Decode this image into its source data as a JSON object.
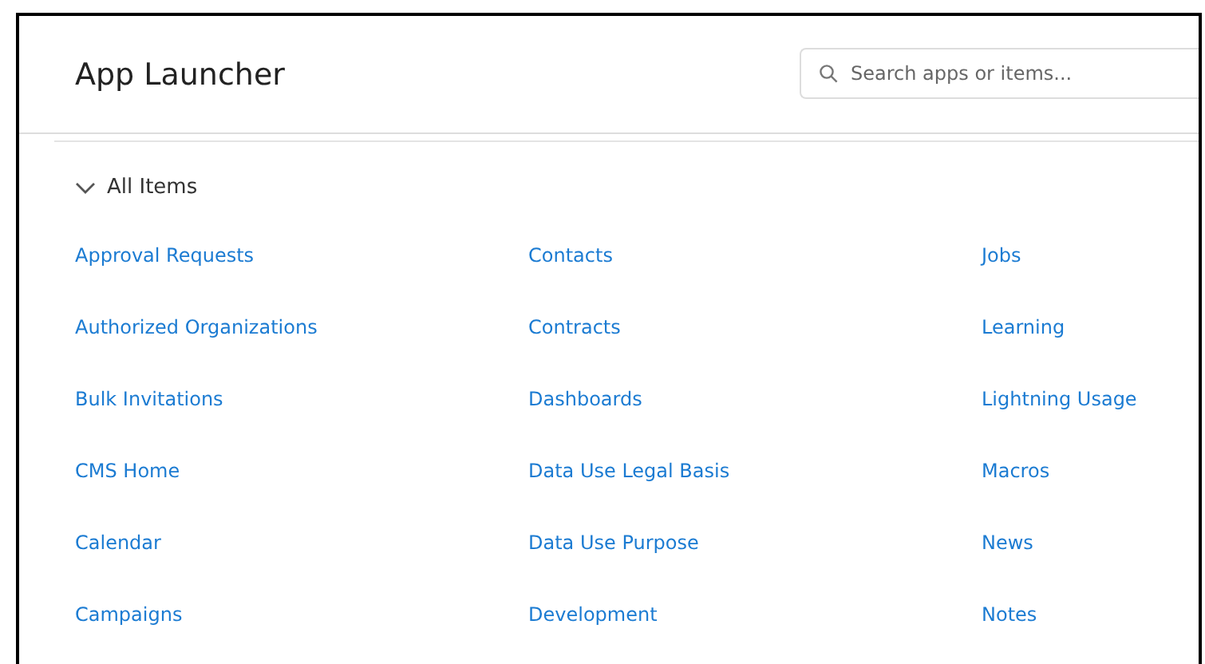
{
  "header": {
    "title": "App Launcher",
    "search": {
      "placeholder": "Search apps or items..."
    }
  },
  "section": {
    "label": "All Items",
    "expanded": true,
    "columns": [
      [
        "Approval Requests",
        "Authorized Organizations",
        "Bulk Invitations",
        "CMS Home",
        "Calendar",
        "Campaigns"
      ],
      [
        "Contacts",
        "Contracts",
        "Dashboards",
        "Data Use Legal Basis",
        "Data Use Purpose",
        "Development"
      ],
      [
        "Jobs",
        "Learning",
        "Lightning Usage",
        "Macros",
        "News",
        "Notes"
      ]
    ]
  }
}
